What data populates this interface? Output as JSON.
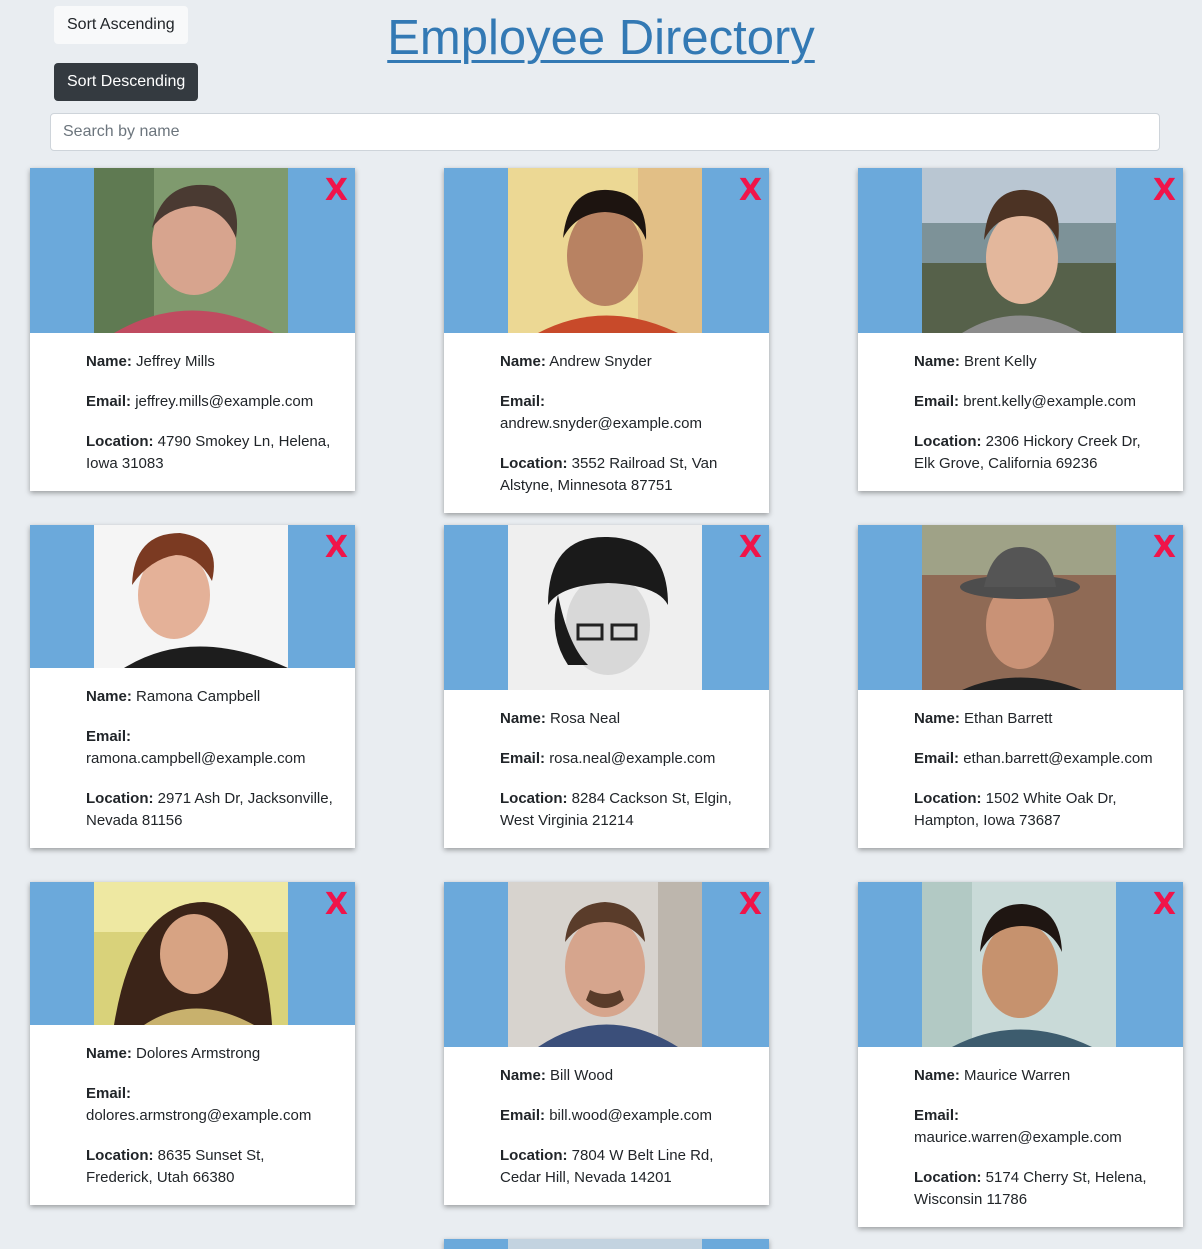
{
  "header": {
    "title": "Employee Directory",
    "sort_ascending_label": "Sort Ascending",
    "sort_descending_label": "Sort Descending",
    "search_placeholder": "Search by name"
  },
  "labels": {
    "name": "Name:",
    "email": "Email:",
    "location": "Location:",
    "delete": "X"
  },
  "theme": {
    "card_top_color": "#6ba9db",
    "delete_color": "#f0144a",
    "title_color": "#3379b4"
  },
  "employees": [
    {
      "name": "Jeffrey Mills",
      "email": "jeffrey.mills@example.com",
      "location": "4790 Smokey Ln, Helena, Iowa 31083"
    },
    {
      "name": "Andrew Snyder",
      "email": "andrew.snyder@example.com",
      "location": "3552 Railroad St, Van Alstyne, Minnesota 87751"
    },
    {
      "name": "Brent Kelly",
      "email": "brent.kelly@example.com",
      "location": "2306 Hickory Creek Dr, Elk Grove, California 69236"
    },
    {
      "name": "Ramona Campbell",
      "email": "ramona.campbell@example.com",
      "location": "2971 Ash Dr, Jacksonville, Nevada 81156"
    },
    {
      "name": "Rosa Neal",
      "email": "rosa.neal@example.com",
      "location": "8284 Cackson St, Elgin, West Virginia 21214"
    },
    {
      "name": "Ethan Barrett",
      "email": "ethan.barrett@example.com",
      "location": "1502 White Oak Dr, Hampton, Iowa 73687"
    },
    {
      "name": "Dolores Armstrong",
      "email": "dolores.armstrong@example.com",
      "location": "8635 Sunset St, Frederick, Utah 66380"
    },
    {
      "name": "Bill Wood",
      "email": "bill.wood@example.com",
      "location": "7804 W Belt Line Rd, Cedar Hill, Nevada 14201"
    },
    {
      "name": "Maurice Warren",
      "email": "maurice.warren@example.com",
      "location": "5174 Cherry St, Helena, Wisconsin 11786"
    }
  ]
}
